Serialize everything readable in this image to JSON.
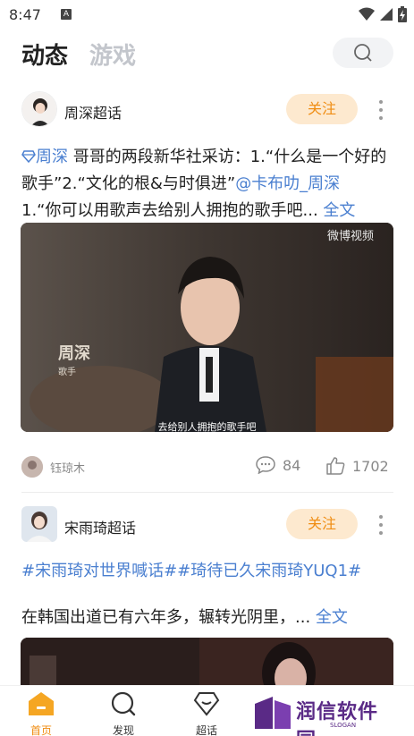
{
  "status": {
    "time": "8:47",
    "notif_icon": "A"
  },
  "header": {
    "tab_active": "动态",
    "tab_inactive": "游戏"
  },
  "posts": [
    {
      "supertopic": "周深超话",
      "follow_label": "关注",
      "text": {
        "mention_1": "周深",
        "body_1": " 哥哥的两段新华社采访：1.“什么是一个好的歌手”2.“文化的根&与时俱进”",
        "mention_2": "@卡布叻_周深",
        "body_2": "1.“你可以用歌声去给别人拥抱的歌手吧...",
        "more": " 全文"
      },
      "video": {
        "watermark": "微博视频",
        "name": "周深",
        "role": "歌手",
        "subtitle": "去给别人拥抱的歌手吧"
      },
      "footer": {
        "user": "钰琼木",
        "comments": "84",
        "likes": "1702"
      }
    },
    {
      "supertopic": "宋雨琦超话",
      "follow_label": "关注",
      "topics": "#宋雨琦对世界喊话##琦待已久宋雨琦YUQ1#",
      "text": {
        "body": "在韩国出道已有六年多，辗转光阴里，...",
        "more": " 全文"
      }
    }
  ],
  "nav": [
    {
      "label": "首页",
      "icon": "home-icon",
      "active": true
    },
    {
      "label": "发现",
      "icon": "discover-icon",
      "active": false
    },
    {
      "label": "超话",
      "icon": "supertopic-icon",
      "active": false
    }
  ],
  "watermark": {
    "text": "润信软件园",
    "slogan": "SLOGAN"
  },
  "colors": {
    "accent": "#f08d13",
    "follow_bg": "#fde9cf",
    "link": "#4a7fd0"
  }
}
